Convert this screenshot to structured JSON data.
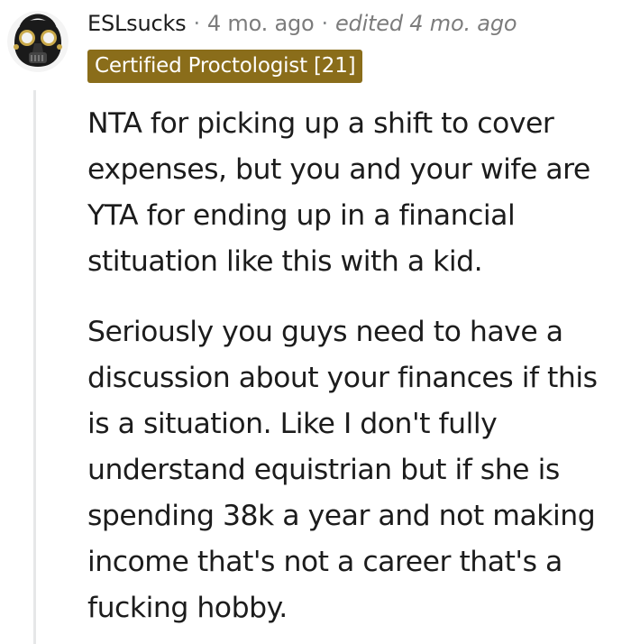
{
  "comment": {
    "username": "ESLsucks",
    "separator": "·",
    "timestamp": "4 mo. ago",
    "edited": "edited 4 mo. ago",
    "flair": "Certified Proctologist [21]",
    "paragraphs": [
      "NTA for picking up a shift to cover expenses, but you and your wife are YTA for ending up in a financial stituation like this with a kid.",
      "Seriously you guys need to have a discussion about your finances if this is a situation. Like I don't fully understand equistrian but if she is spending 38k a year and not making income that's not a career that's a fucking hobby."
    ],
    "avatar_icon": "gas-mask-avatar",
    "colors": {
      "flair_background": "#8a6d1a",
      "flair_text": "#ffffff",
      "meta_text": "#7c7c7c",
      "body_text": "#1c1c1c",
      "thread_line": "#e6e7e8"
    }
  }
}
